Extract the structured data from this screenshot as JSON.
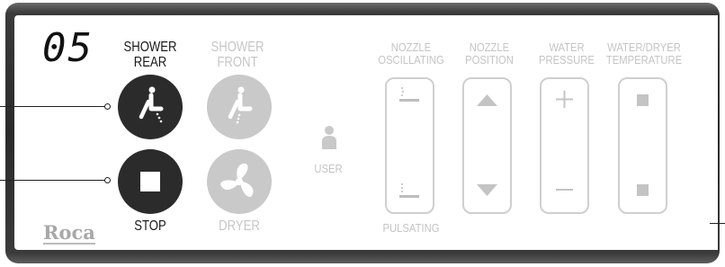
{
  "display": {
    "value": "05"
  },
  "buttons": {
    "shower_rear": {
      "label_line1": "SHOWER",
      "label_line2": "REAR",
      "icon": "rear-wash-icon",
      "color": "#2b2b2b"
    },
    "shower_front": {
      "label_line1": "SHOWER",
      "label_line2": "FRONT",
      "icon": "front-wash-icon",
      "color": "#c9c9c9"
    },
    "stop": {
      "label": "STOP",
      "icon": "stop-icon",
      "color": "#2b2b2b"
    },
    "dryer": {
      "label": "DRYER",
      "icon": "fan-icon",
      "color": "#c9c9c9"
    }
  },
  "user": {
    "label": "USER",
    "icon": "person-icon"
  },
  "controls": {
    "nozzle_oscillating": {
      "label_line1": "NOZZLE",
      "label_line2": "OSCILLATING",
      "bottom_label": "PULSATING"
    },
    "nozzle_position": {
      "label_line1": "NOZZLE",
      "label_line2": "POSITION",
      "up_icon": "triangle-up-icon",
      "down_icon": "triangle-down-icon"
    },
    "water_pressure": {
      "label_line1": "WATER",
      "label_line2": "PRESSURE",
      "plus_icon": "plus-icon",
      "minus_icon": "minus-icon"
    },
    "temperature": {
      "label_line1": "WATER/DRYER",
      "label_line2": "TEMPERATURE",
      "icon": "square-icon"
    }
  },
  "brand": {
    "logo_text": "Roca"
  }
}
